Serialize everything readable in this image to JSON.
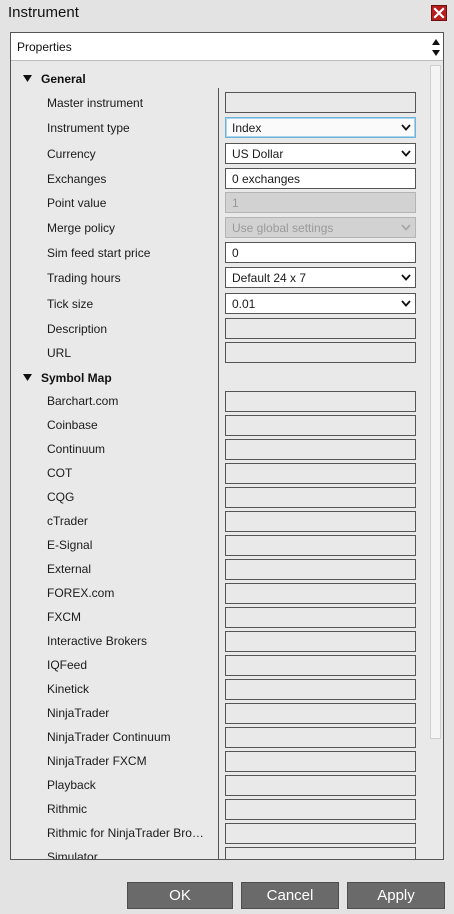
{
  "window": {
    "title": "Instrument",
    "close_icon": "close-icon"
  },
  "properties_header": {
    "label": "Properties"
  },
  "general": {
    "title": "General",
    "rows": [
      {
        "label": "Master instrument",
        "value": "",
        "kind": "text"
      },
      {
        "label": "Instrument type",
        "value": "Index",
        "kind": "select",
        "state": "focused"
      },
      {
        "label": "Currency",
        "value": "US Dollar",
        "kind": "select"
      },
      {
        "label": "Exchanges",
        "value": "0 exchanges",
        "kind": "text-white"
      },
      {
        "label": "Point value",
        "value": "1",
        "kind": "disabled"
      },
      {
        "label": "Merge policy",
        "value": "Use global settings",
        "kind": "disabled-select"
      },
      {
        "label": "Sim feed start price",
        "value": "0",
        "kind": "text-white"
      },
      {
        "label": "Trading hours",
        "value": "Default 24 x 7",
        "kind": "select"
      },
      {
        "label": "Tick size",
        "value": "0.01",
        "kind": "select"
      },
      {
        "label": "Description",
        "value": "",
        "kind": "text"
      },
      {
        "label": "URL",
        "value": "",
        "kind": "text"
      }
    ]
  },
  "symbol_map": {
    "title": "Symbol Map",
    "rows": [
      {
        "label": "Barchart.com",
        "value": ""
      },
      {
        "label": "Coinbase",
        "value": ""
      },
      {
        "label": "Continuum",
        "value": ""
      },
      {
        "label": "COT",
        "value": ""
      },
      {
        "label": "CQG",
        "value": ""
      },
      {
        "label": "cTrader",
        "value": ""
      },
      {
        "label": "E-Signal",
        "value": ""
      },
      {
        "label": "External",
        "value": ""
      },
      {
        "label": "FOREX.com",
        "value": ""
      },
      {
        "label": "FXCM",
        "value": ""
      },
      {
        "label": "Interactive Brokers",
        "value": ""
      },
      {
        "label": "IQFeed",
        "value": ""
      },
      {
        "label": "Kinetick",
        "value": ""
      },
      {
        "label": "NinjaTrader",
        "value": ""
      },
      {
        "label": "NinjaTrader Continuum",
        "value": ""
      },
      {
        "label": "NinjaTrader FXCM",
        "value": ""
      },
      {
        "label": "Playback",
        "value": ""
      },
      {
        "label": "Rithmic",
        "value": ""
      },
      {
        "label": "Rithmic for NinjaTrader Bro…",
        "value": ""
      },
      {
        "label": "Simulator",
        "value": ""
      }
    ]
  },
  "footer": {
    "ok": "OK",
    "cancel": "Cancel",
    "apply": "Apply"
  },
  "colors": {
    "window_bg": "#e3e3e3",
    "close_button": "#b81e1e",
    "footer_button": "#6a6a6a",
    "focus_border": "#6fb4d8"
  },
  "icons": {
    "section_toggle": "triangle-down-icon",
    "dropdown": "chevron-down-icon",
    "spinner_up": "spinner-up-icon",
    "spinner_down": "spinner-down-icon"
  }
}
